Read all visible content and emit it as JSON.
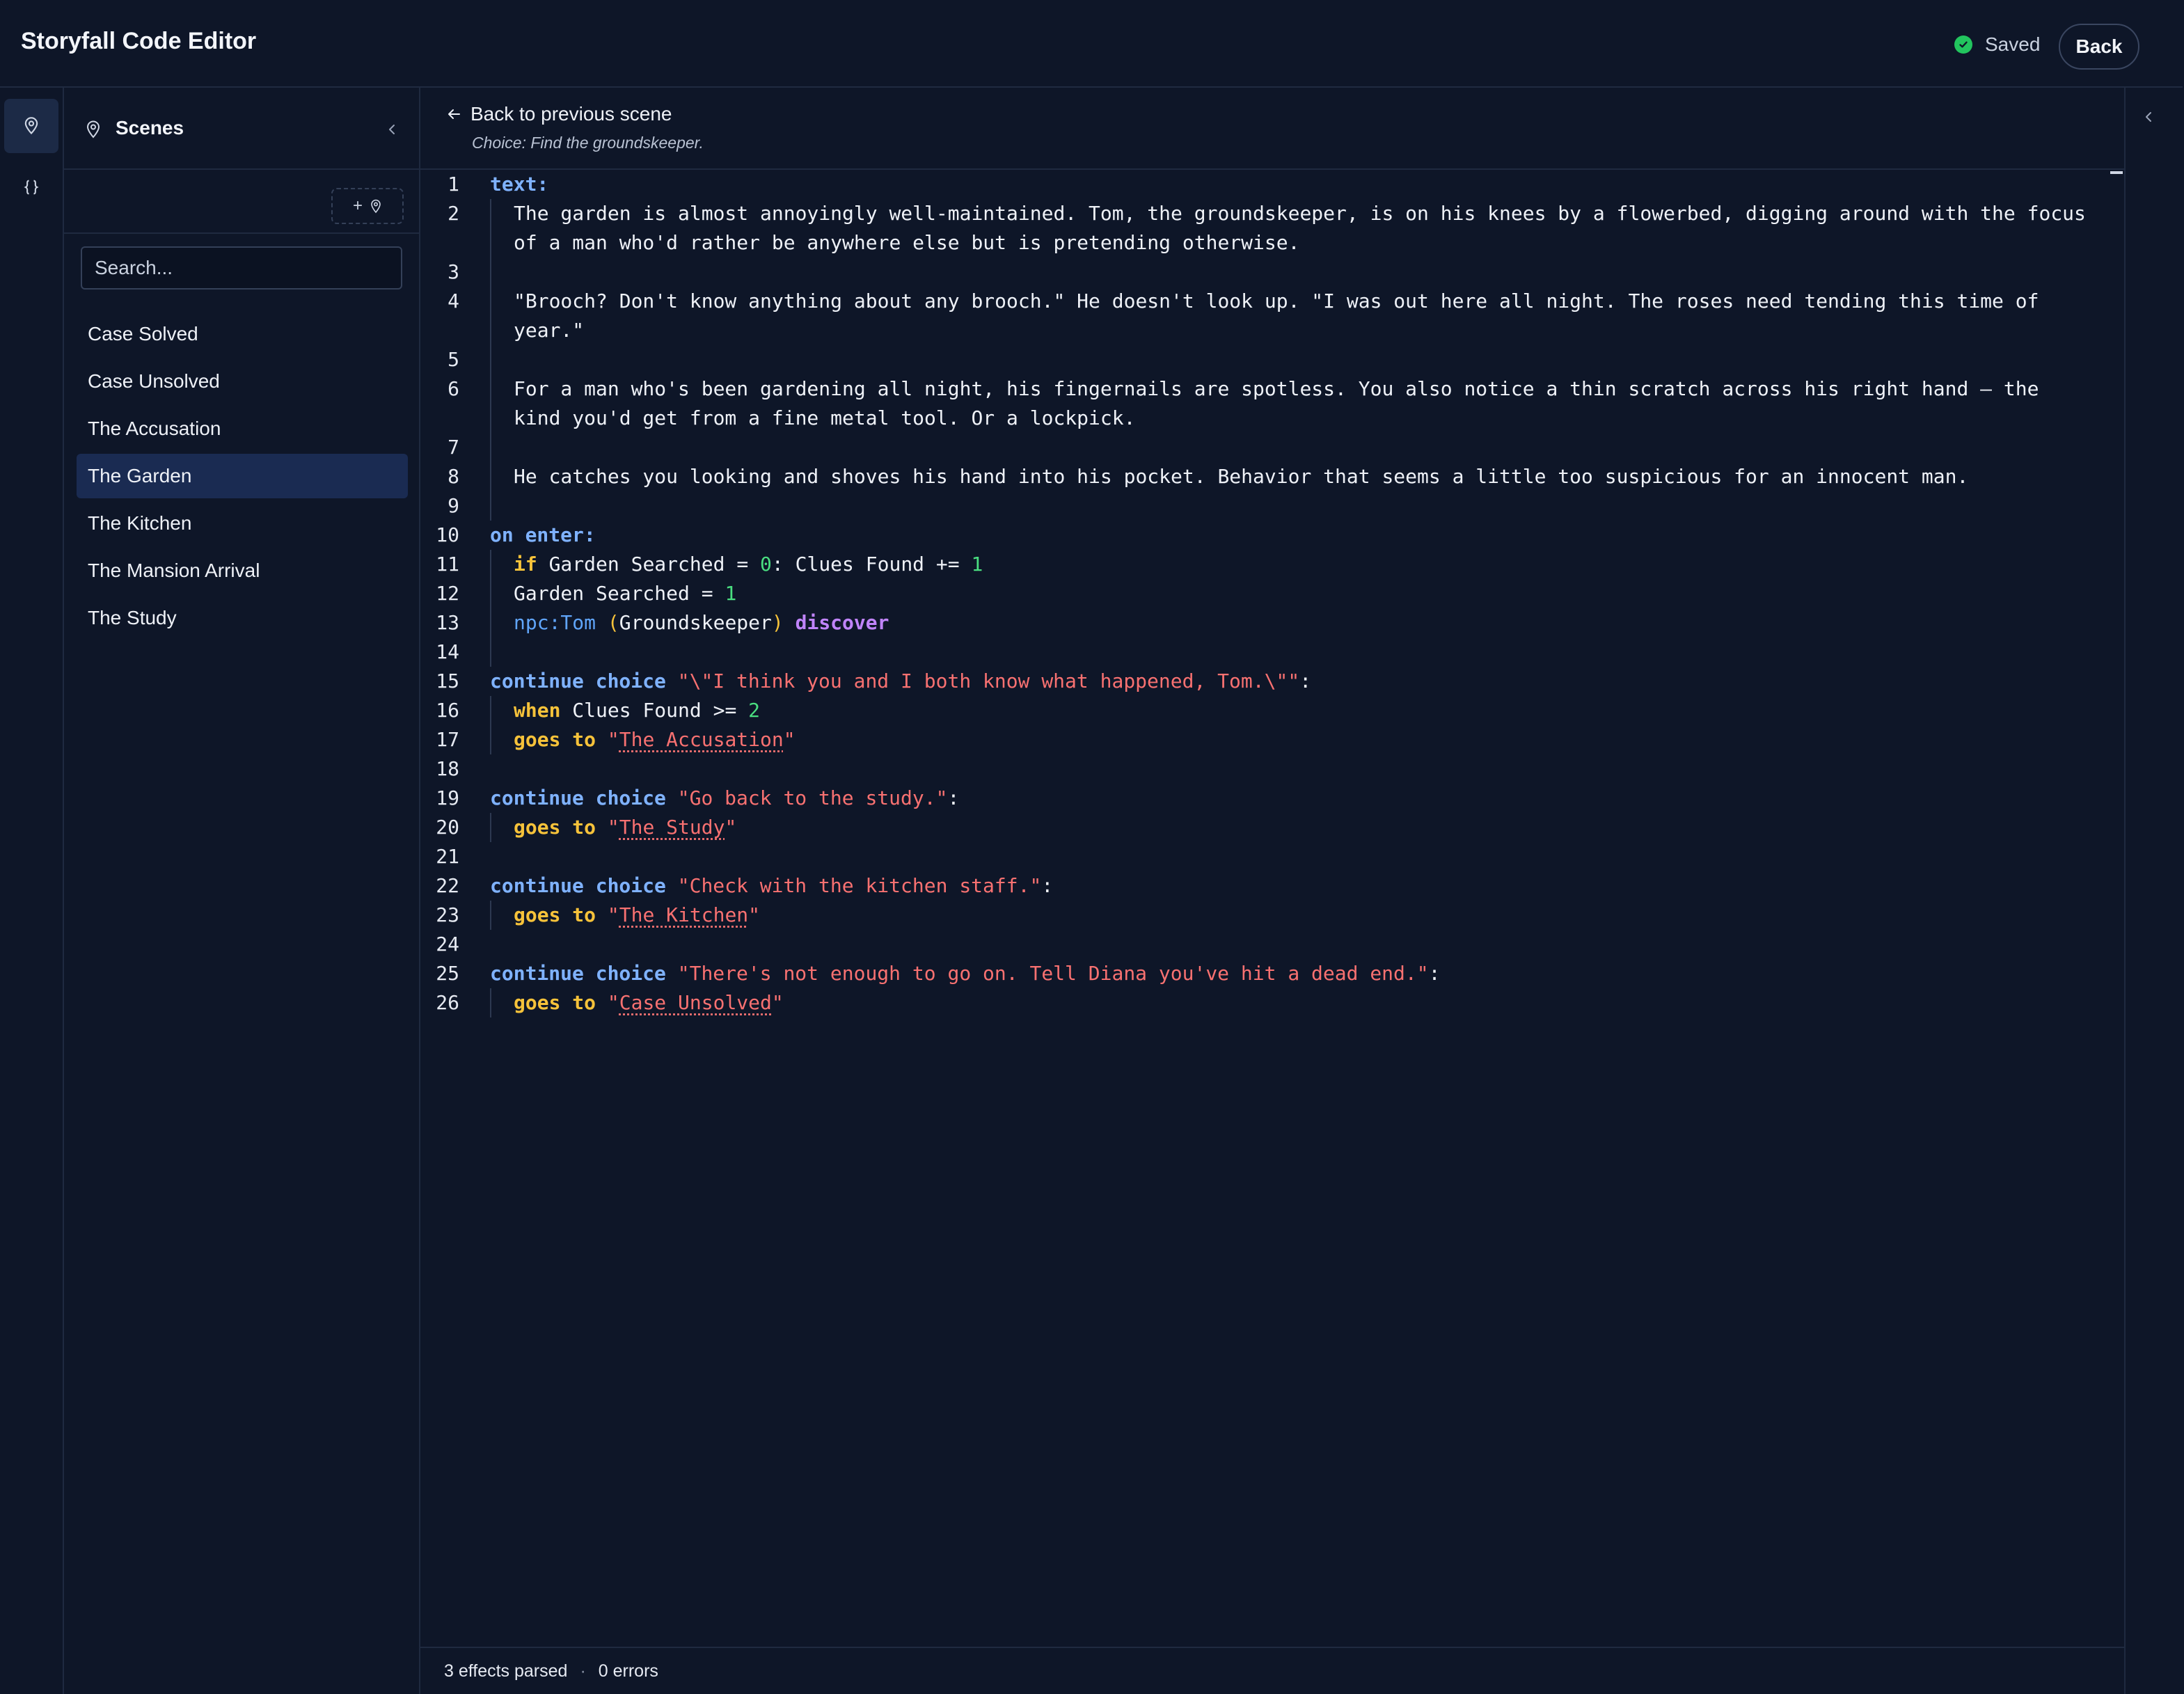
{
  "app": {
    "title": "Storyfall Code Editor"
  },
  "header": {
    "save_status": "Saved",
    "back_label": "Back"
  },
  "rail": {
    "items": [
      {
        "icon": "map-pin-icon",
        "active": true
      },
      {
        "icon": "braces-icon",
        "active": false
      }
    ]
  },
  "sidebar": {
    "title": "Scenes",
    "add_scene_label": "+",
    "search_placeholder": "Search...",
    "scenes": [
      "Case Solved",
      "Case Unsolved",
      "The Accusation",
      "The Garden",
      "The Kitchen",
      "The Mansion Arrival",
      "The Study"
    ],
    "selected": "The Garden"
  },
  "breadcrumb": {
    "back_label": "Back to previous scene",
    "subtitle": "Choice: Find the groundskeeper."
  },
  "editor": {
    "line_numbers": [
      "1",
      "2",
      "3",
      "4",
      "5",
      "6",
      "7",
      "8",
      "9",
      "10",
      "11",
      "12",
      "13",
      "14",
      "15",
      "16",
      "17",
      "18",
      "19",
      "20",
      "21",
      "22",
      "23",
      "24",
      "25",
      "26"
    ],
    "text": {
      "l1": "text:",
      "l2a": "The garden is almost annoyingly well-maintained. Tom, the groundskeeper, is on his knees by a flowerbed, digging around with the focus",
      "l2b": "of a man who'd rather be anywhere else but is pretending otherwise.",
      "l4a": "\"Brooch? Don't know anything about any brooch.\" He doesn't look up. \"I was out here all night. The roses need tending this time of",
      "l4b": "year.\"",
      "l6a": "For a man who's been gardening all night, his fingernails are spotless. You also notice a thin scratch across his right hand — the",
      "l6b": "kind you'd get from a fine metal tool. Or a lockpick.",
      "l8": "He catches you looking and shoves his hand into his pocket. Behavior that seems a little too suspicious for an innocent man.",
      "l10": "on enter:",
      "if": "if",
      "garden_searched": "Garden Searched",
      "eq": "=",
      "zero": "0",
      "colon": ":",
      "clues_found": "Clues Found",
      "plus_eq": "+=",
      "one": "1",
      "npc": "npc:Tom",
      "lparen": "(",
      "groundskeeper": "Groundskeeper",
      "rparen": ")",
      "discover": "discover",
      "continue_choice": "continue choice",
      "when": "when",
      "gte": ">=",
      "two": "2",
      "goes_to": "goes to",
      "quote": "\"",
      "c15": "\"\\\"I think you and I both know what happened, Tom.\\\"\"",
      "c19": "\"Go back to the study.\"",
      "c22": "\"Check with the kitchen staff.\"",
      "c25": "\"There's not enough to go on. Tell Diana you've hit a dead end.\"",
      "t17": "The Accusation",
      "t20": "The Study",
      "t23": "The Kitchen",
      "t26": "Case Unsolved"
    }
  },
  "status": {
    "effects": "3 effects parsed",
    "separator": "·",
    "errors": "0 errors"
  },
  "colors": {
    "background": "#0e1628",
    "selected": "#1a2b52",
    "keyword": "#7fb2ff",
    "keyword_alt": "#f6c23a",
    "number": "#4ade80",
    "string": "#f87171",
    "saved": "#22c55e"
  }
}
